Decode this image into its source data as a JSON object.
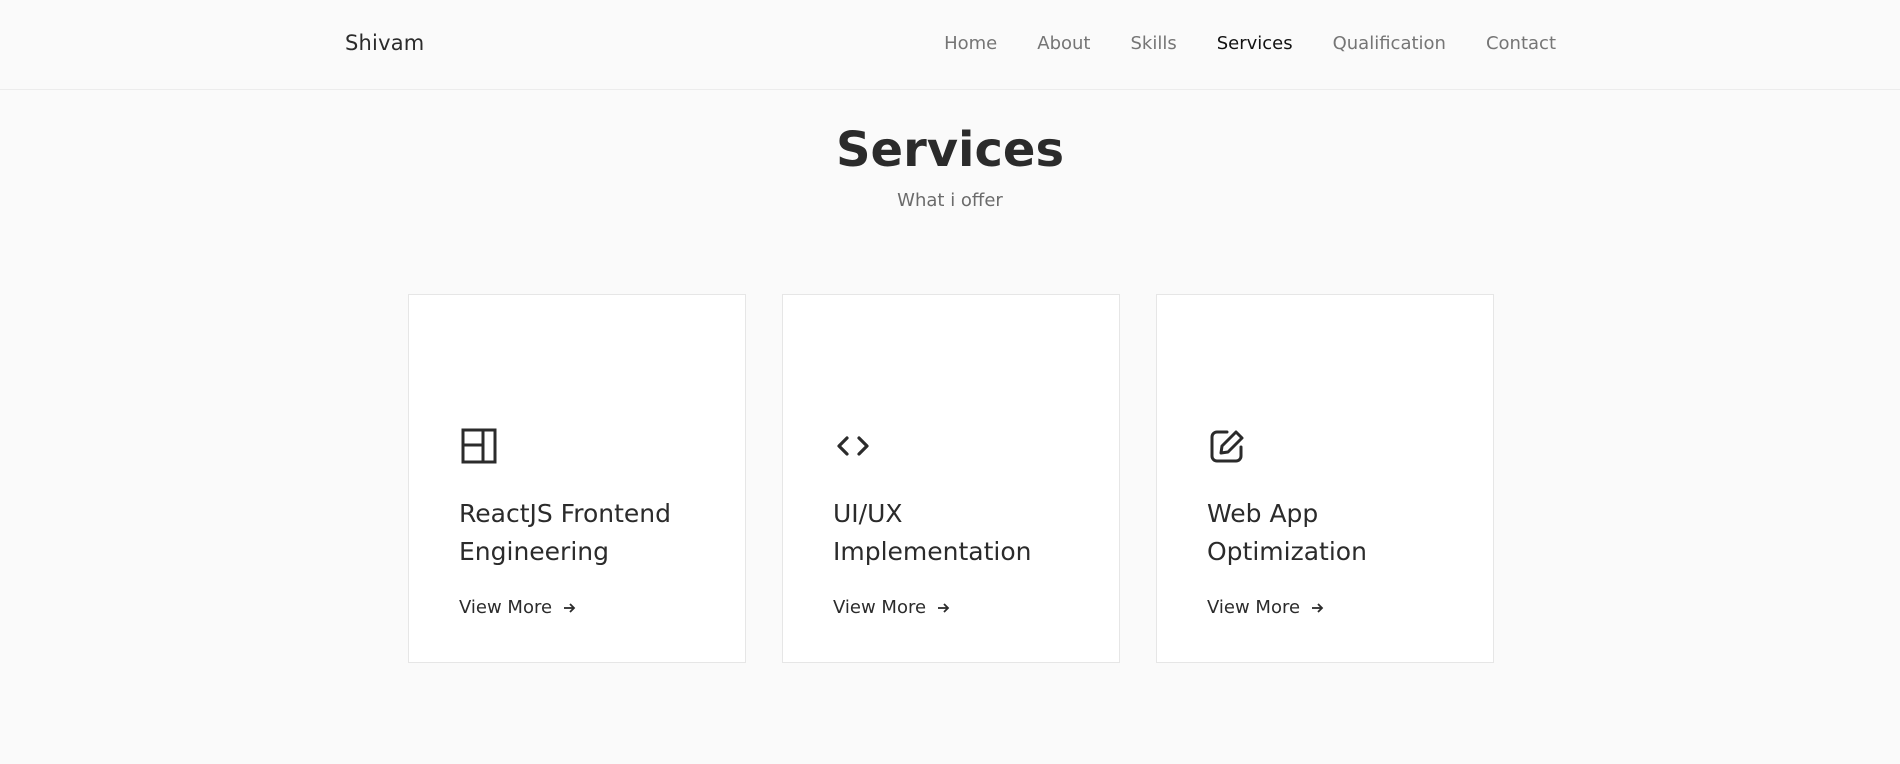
{
  "header": {
    "logo": "Shivam",
    "nav": [
      {
        "label": "Home",
        "active": false
      },
      {
        "label": "About",
        "active": false
      },
      {
        "label": "Skills",
        "active": false
      },
      {
        "label": "Services",
        "active": true
      },
      {
        "label": "Qualification",
        "active": false
      },
      {
        "label": "Contact",
        "active": false
      }
    ]
  },
  "section": {
    "title": "Services",
    "subtitle": "What i offer"
  },
  "services": [
    {
      "icon": "layout-icon",
      "title": "ReactJS Frontend Engineering",
      "link": "View More"
    },
    {
      "icon": "code-icon",
      "title": "UI/UX Implementation",
      "link": "View More"
    },
    {
      "icon": "edit-icon",
      "title": "Web App Optimization",
      "link": "View More"
    }
  ],
  "colors": {
    "background": "#fafafa",
    "text": "#2b2b2b",
    "muted": "#757575",
    "active": "#111111"
  }
}
